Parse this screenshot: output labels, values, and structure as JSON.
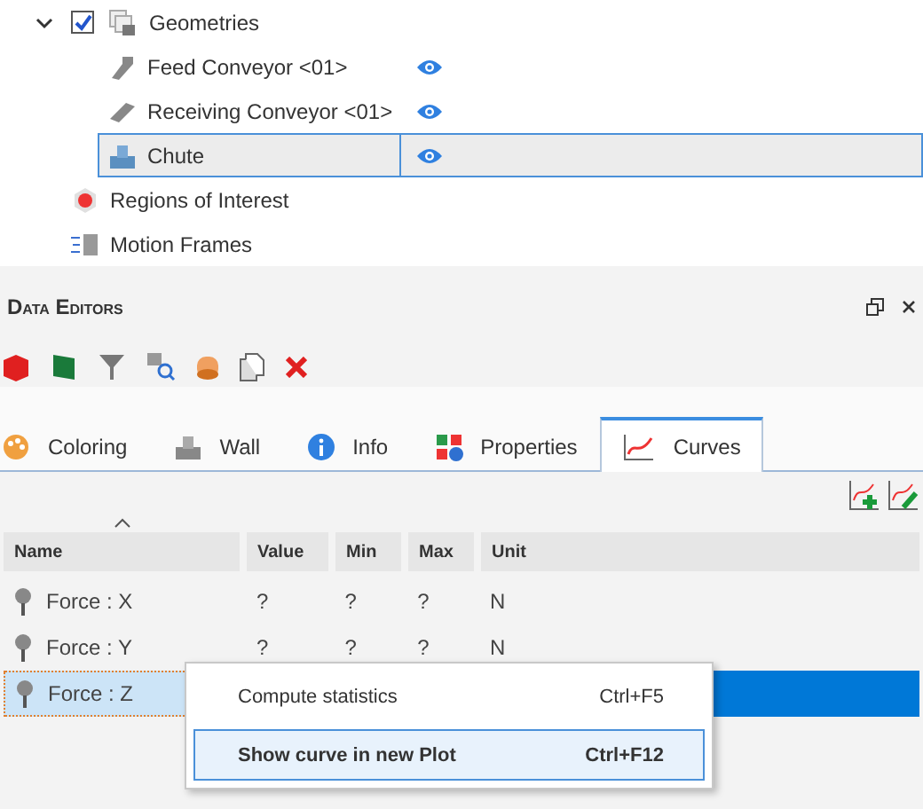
{
  "tree": {
    "items": [
      {
        "label": "Geometries",
        "kind": "geometries",
        "expanded": true,
        "checked": true,
        "children": [
          {
            "label": "Feed Conveyor <01>",
            "kind": "conveyor",
            "visible": true,
            "selected": false
          },
          {
            "label": "Receiving Conveyor <01>",
            "kind": "belt",
            "visible": true,
            "selected": false
          },
          {
            "label": "Chute",
            "kind": "chute",
            "visible": true,
            "selected": true
          }
        ]
      },
      {
        "label": "Regions of Interest",
        "kind": "region"
      },
      {
        "label": "Motion Frames",
        "kind": "motion"
      }
    ]
  },
  "panel": {
    "title": "Data Editors",
    "tabs": [
      {
        "label": "Coloring",
        "kind": "coloring",
        "selected": false
      },
      {
        "label": "Wall",
        "kind": "wall",
        "selected": false
      },
      {
        "label": "Info",
        "kind": "info",
        "selected": false
      },
      {
        "label": "Properties",
        "kind": "properties",
        "selected": false
      },
      {
        "label": "Curves",
        "kind": "curves",
        "selected": true
      }
    ],
    "table": {
      "columns": [
        {
          "label": "Name",
          "sorted": true
        },
        {
          "label": "Value",
          "sorted": false
        },
        {
          "label": "Min",
          "sorted": false
        },
        {
          "label": "Max",
          "sorted": false
        },
        {
          "label": "Unit",
          "sorted": false
        }
      ],
      "rows": [
        {
          "cells": [
            "Force : X",
            "?",
            "?",
            "?",
            "N"
          ],
          "selected": false
        },
        {
          "cells": [
            "Force : Y",
            "?",
            "?",
            "?",
            "N"
          ],
          "selected": false
        },
        {
          "cells": [
            "Force : Z"
          ],
          "selected": true
        }
      ]
    },
    "context_menu": {
      "items": [
        {
          "label": "Compute statistics",
          "shortcut": "Ctrl+F5",
          "selected": false
        },
        {
          "label": "Show curve in new Plot",
          "shortcut": "Ctrl+F12",
          "selected": true
        }
      ]
    }
  }
}
